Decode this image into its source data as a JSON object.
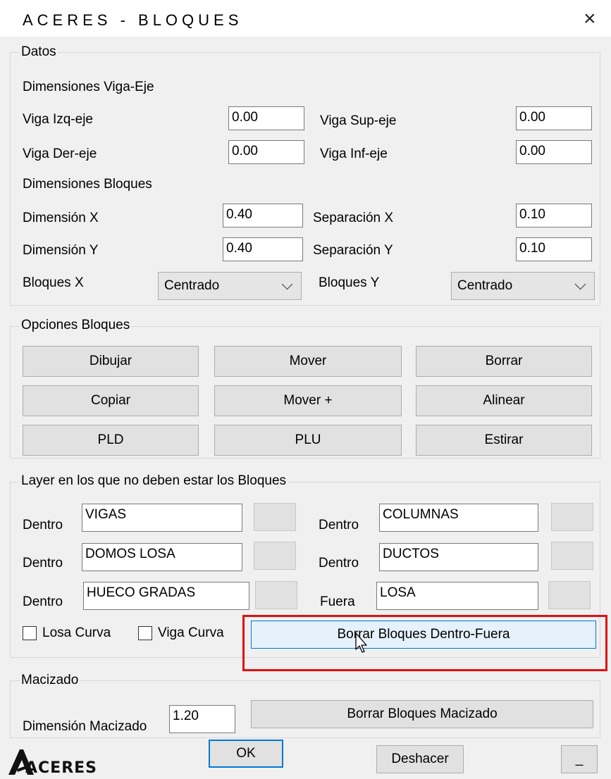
{
  "window": {
    "title": "ACERES - BLOQUES",
    "close_glyph": "×"
  },
  "datos": {
    "legend": "Datos",
    "viga_eje_heading": "Dimensiones Viga-Eje",
    "viga_izq_label": "Viga Izq-eje",
    "viga_izq_value": "0.00",
    "viga_sup_label": "Viga Sup-eje",
    "viga_sup_value": "0.00",
    "viga_der_label": "Viga Der-eje",
    "viga_der_value": "0.00",
    "viga_inf_label": "Viga Inf-eje",
    "viga_inf_value": "0.00",
    "bloques_heading": "Dimensiones Bloques",
    "dim_x_label": "Dimensión X",
    "dim_x_value": "0.40",
    "sep_x_label": "Separación X",
    "sep_x_value": "0.10",
    "dim_y_label": "Dimensión Y",
    "dim_y_value": "0.40",
    "sep_y_label": "Separación Y",
    "sep_y_value": "0.10",
    "bloques_x_label": "Bloques X",
    "bloques_x_value": "Centrado",
    "bloques_y_label": "Bloques Y",
    "bloques_y_value": "Centrado"
  },
  "opciones": {
    "legend": "Opciones Bloques",
    "buttons": [
      "Dibujar",
      "Mover",
      "Borrar",
      "Copiar",
      "Mover +",
      "Alinear",
      "PLD",
      "PLU",
      "Estirar"
    ]
  },
  "layers": {
    "legend": "Layer en los que no deben estar los Bloques",
    "rows": [
      {
        "label": "Dentro",
        "value": "VIGAS"
      },
      {
        "label": "Dentro",
        "value": "COLUMNAS"
      },
      {
        "label": "Dentro",
        "value": "DOMOS LOSA"
      },
      {
        "label": "Dentro",
        "value": "DUCTOS"
      },
      {
        "label": "Dentro",
        "value": "HUECO GRADAS"
      },
      {
        "label": "Fuera",
        "value": "LOSA"
      }
    ],
    "losa_curva_label": "Losa Curva",
    "viga_curva_label": "Viga Curva",
    "borrar_dentro_fuera_label": "Borrar Bloques Dentro-Fuera"
  },
  "macizado": {
    "legend": "Macizado",
    "dim_label": "Dimensión Macizado",
    "dim_value": "1.20",
    "borrar_label": "Borrar Bloques Macizado"
  },
  "footer": {
    "logo_text": "ACERES",
    "ok_label": "OK",
    "deshacer_label": "Deshacer",
    "minimize_label": "_"
  },
  "colors": {
    "highlight": "#e01010",
    "focused_button": "#e5f1fb",
    "focused_border": "#0078d7"
  }
}
